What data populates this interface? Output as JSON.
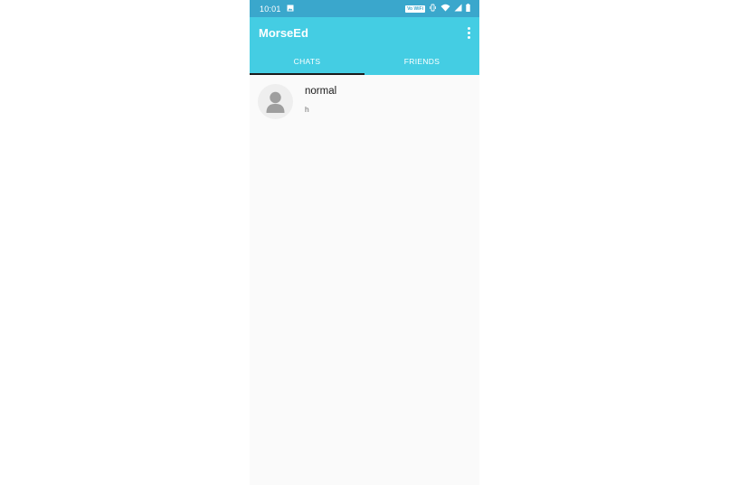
{
  "status_bar": {
    "time": "10:01",
    "badge": "Vo WiFi"
  },
  "app_bar": {
    "title": "MorseEd"
  },
  "tabs": [
    {
      "label": "CHATS",
      "active": true
    },
    {
      "label": "FRIENDS",
      "active": false
    }
  ],
  "chats": [
    {
      "name": "normal",
      "preview": "h"
    }
  ],
  "colors": {
    "status_bar": "#3aa7cc",
    "app_bar": "#44cde3",
    "tab_indicator": "#1a1a1a",
    "background": "#fafafa"
  }
}
